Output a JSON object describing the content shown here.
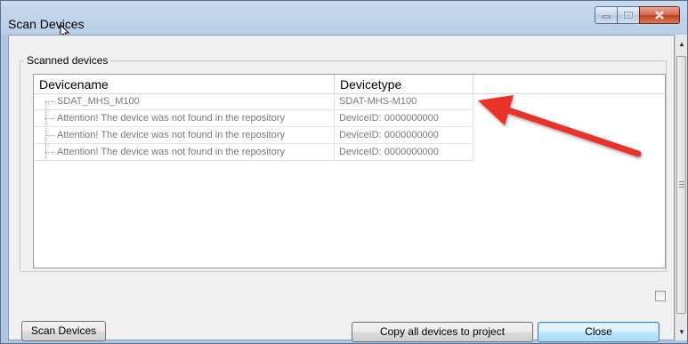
{
  "window": {
    "title": "Scan Devices",
    "controls": {
      "minimize": "minimize-icon",
      "maximize": "maximize-icon",
      "close": "close-icon"
    }
  },
  "group": {
    "label": "Scanned devices"
  },
  "table": {
    "columns": [
      "Devicename",
      "Devicetype"
    ],
    "rows": [
      {
        "name": "SDAT_MHS_M100",
        "type": "SDAT-MHS-M100"
      },
      {
        "name": "Attention! The device was not found in the repository",
        "type": "DeviceID:  0000000000"
      },
      {
        "name": "Attention! The device was not found in the repository",
        "type": "DeviceID:  0000000000"
      },
      {
        "name": "Attention! The device was not found in the repository",
        "type": "DeviceID:  0000000000"
      }
    ]
  },
  "buttons": {
    "scan": "Scan Devices",
    "copy": "Copy all devices to project",
    "close": "Close"
  },
  "colors": {
    "annotation_arrow": "#e8322c",
    "close_button": "#c2401f"
  }
}
